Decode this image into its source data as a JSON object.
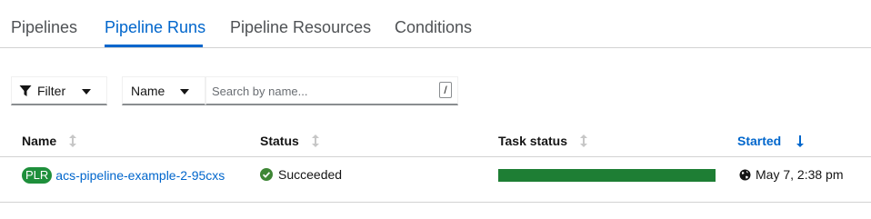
{
  "tabs": [
    {
      "label": "Pipelines",
      "active": false
    },
    {
      "label": "Pipeline Runs",
      "active": true
    },
    {
      "label": "Pipeline Resources",
      "active": false
    },
    {
      "label": "Conditions",
      "active": false
    }
  ],
  "toolbar": {
    "filter_label": "Filter",
    "name_select_value": "Name",
    "search_placeholder": "Search by name...",
    "search_shortcut": "/"
  },
  "table": {
    "columns": [
      {
        "label": "Name",
        "sorted": false
      },
      {
        "label": "Status",
        "sorted": false
      },
      {
        "label": "Task status",
        "sorted": false
      },
      {
        "label": "Started",
        "sorted": true,
        "direction": "desc"
      }
    ],
    "rows": [
      {
        "badge": "PLR",
        "name": "acs-pipeline-example-2-95cxs",
        "status": "Succeeded",
        "task_progress": 1.0,
        "started": "May 7, 2:38 pm"
      }
    ]
  },
  "colors": {
    "accent": "#0066cc",
    "success": "#1e8f3b",
    "task_bar": "#1e7e34"
  },
  "icons": {
    "filter": "funnel-icon",
    "sort_inactive": "sort-updown-icon",
    "sort_active": "arrow-down-icon",
    "status": "check-circle-icon",
    "started": "globe-icon"
  }
}
